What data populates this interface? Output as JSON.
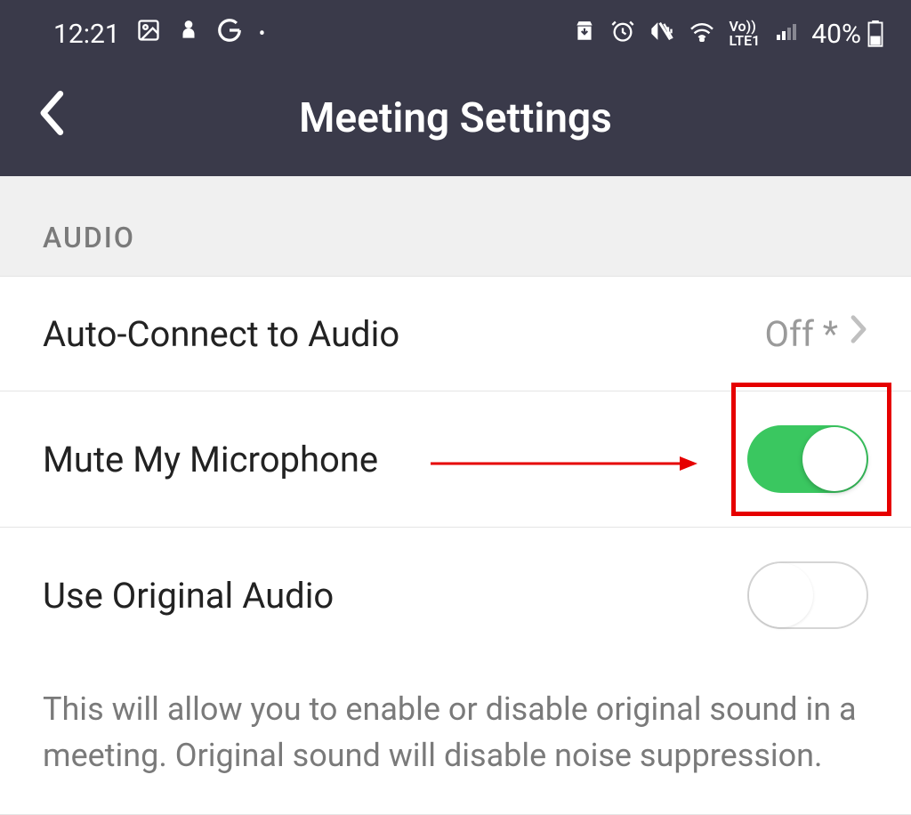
{
  "statusbar": {
    "time": "12:21",
    "battery_pct": "40%"
  },
  "nav": {
    "title": "Meeting Settings"
  },
  "sections": {
    "audio": {
      "header": "AUDIO",
      "auto_connect": {
        "label": "Auto-Connect to Audio",
        "value": "Off *"
      },
      "mute_mic": {
        "label": "Mute My Microphone",
        "on": true
      },
      "original_audio": {
        "label": "Use Original Audio",
        "on": false,
        "description": "This will allow you to enable or disable original sound in a meeting. Original sound will disable noise suppression."
      }
    }
  }
}
